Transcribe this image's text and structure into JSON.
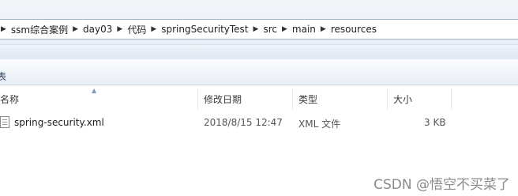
{
  "breadcrumb": {
    "items": [
      "ssm综合案例",
      "day03",
      "代码",
      "springSecurityTest",
      "src",
      "main",
      "resources"
    ]
  },
  "nav": {
    "partial_label": "表"
  },
  "columns": {
    "name": "名称",
    "modified": "修改日期",
    "type": "类型",
    "size": "大小"
  },
  "files": [
    {
      "name": "spring-security.xml",
      "modified": "2018/8/15 12:47",
      "type": "XML 文件",
      "size": "3 KB",
      "icon": "xml-file-icon"
    }
  ],
  "watermark": "CSDN @悟空不买菜了"
}
